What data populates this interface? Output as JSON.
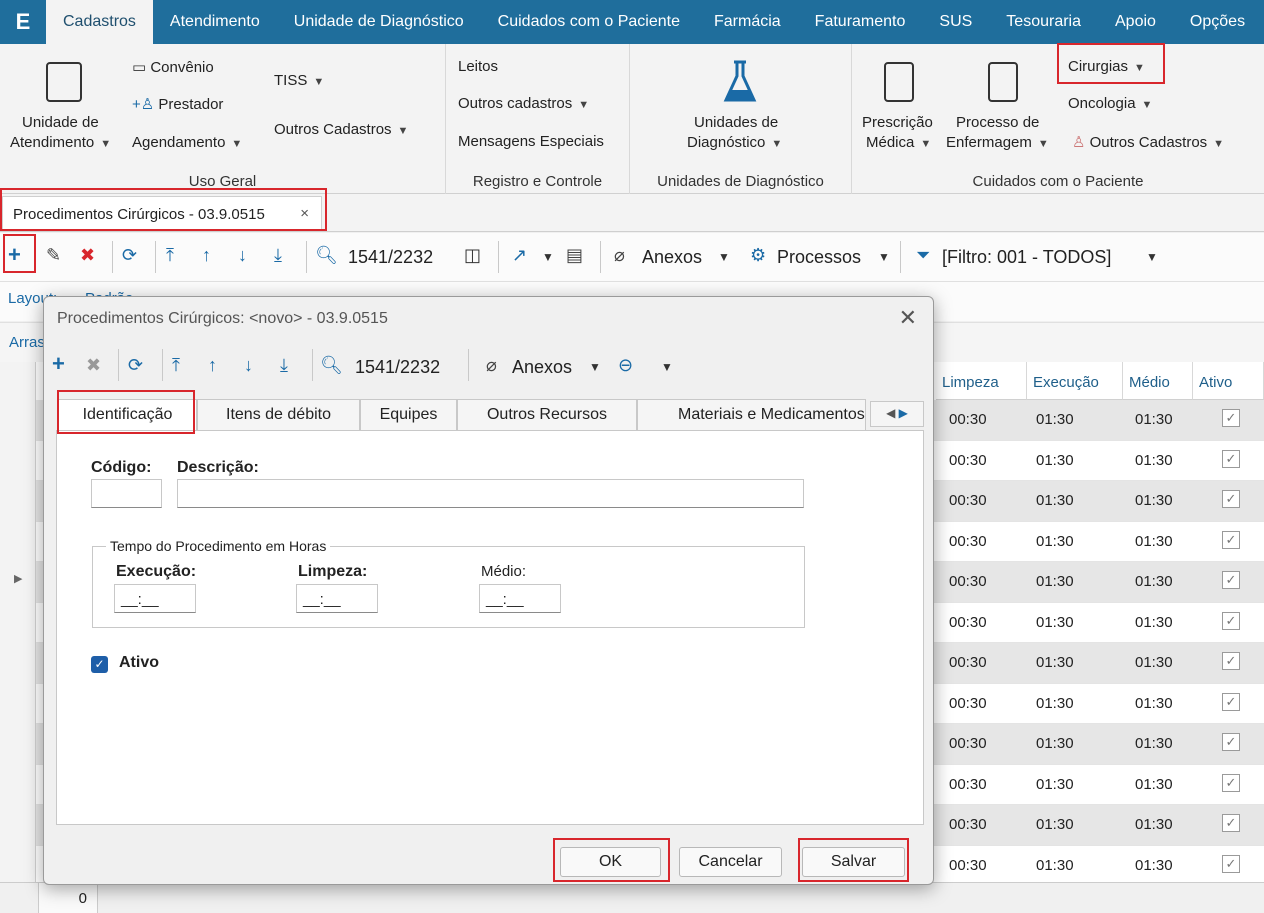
{
  "menubar": {
    "logo": "E",
    "tabs": [
      "Cadastros",
      "Atendimento",
      "Unidade de Diagnóstico",
      "Cuidados com o Paciente",
      "Farmácia",
      "Faturamento",
      "SUS",
      "Tesouraria",
      "Apoio",
      "Opções"
    ]
  },
  "ribbon": {
    "uso_geral": {
      "unidade_atendimento_l1": "Unidade de",
      "unidade_atendimento_l2": "Atendimento",
      "convenio": "Convênio",
      "prestador": "Prestador",
      "agendamento": "Agendamento",
      "tiss": "TISS",
      "outros_cadastros": "Outros Cadastros",
      "label": "Uso Geral"
    },
    "registro": {
      "leitos": "Leitos",
      "outros_cadastros": "Outros cadastros",
      "mensagens": "Mensagens Especiais",
      "label": "Registro e Controle"
    },
    "unidades": {
      "item_l1": "Unidades de",
      "item_l2": "Diagnóstico",
      "label": "Unidades de Diagnóstico"
    },
    "cuidados": {
      "prescricao_l1": "Prescrição",
      "prescricao_l2": "Médica",
      "processo_l1": "Processo de",
      "processo_l2": "Enfermagem",
      "cirurgias": "Cirurgias",
      "oncologia": "Oncologia",
      "outros_cadastros": "Outros Cadastros",
      "label": "Cuidados com o Paciente"
    }
  },
  "doc_tab": {
    "title": "Procedimentos Cirúrgicos - 03.9.0515",
    "close": "×"
  },
  "toolbar": {
    "record_counter": "1541/2232",
    "anexos": "Anexos",
    "processos": "Processos",
    "filtro": "[Filtro: 001 - TODOS]"
  },
  "second_row": {
    "layout": "Layout:",
    "padrao": "Padrão"
  },
  "third_row": {
    "arras": "Arras"
  },
  "grid": {
    "headers": [
      "Limpeza",
      "Execução",
      "Médio",
      "Ativo"
    ],
    "rows": [
      [
        "00:30",
        "01:30",
        "01:30"
      ],
      [
        "00:30",
        "01:30",
        "01:30"
      ],
      [
        "00:30",
        "01:30",
        "01:30"
      ],
      [
        "00:30",
        "01:30",
        "01:30"
      ],
      [
        "00:30",
        "01:30",
        "01:30"
      ],
      [
        "00:30",
        "01:30",
        "01:30"
      ],
      [
        "00:30",
        "01:30",
        "01:30"
      ],
      [
        "00:30",
        "01:30",
        "01:30"
      ],
      [
        "00:30",
        "01:30",
        "01:30"
      ],
      [
        "00:30",
        "01:30",
        "01:30"
      ],
      [
        "00:30",
        "01:30",
        "01:30"
      ],
      [
        "00:30",
        "01:30",
        "01:30"
      ]
    ],
    "footer_count": "0"
  },
  "dialog": {
    "title": "Procedimentos Cirúrgicos: <novo> - 03.9.0515",
    "record_counter": "1541/2232",
    "anexos": "Anexos",
    "tabs": [
      "Identificação",
      "Itens de débito",
      "Equipes",
      "Outros Recursos",
      "Materiais e Medicamentos"
    ],
    "codigo_label": "Código:",
    "descricao_label": "Descrição:",
    "codigo_value": "",
    "descricao_value": "",
    "fieldset_legend": "Tempo do Procedimento em Horas",
    "execucao_label": "Execução:",
    "limpeza_label": "Limpeza:",
    "medio_label": "Médio:",
    "time_mask": "__:__",
    "ativo_label": "Ativo",
    "ativo_checked": true,
    "ok": "OK",
    "cancelar": "Cancelar",
    "salvar": "Salvar"
  },
  "colors": {
    "menubar": "#1f6e9c",
    "accent": "#1a6aa6",
    "highlight": "#d8262c",
    "checkbox": "#1e5ea8"
  }
}
